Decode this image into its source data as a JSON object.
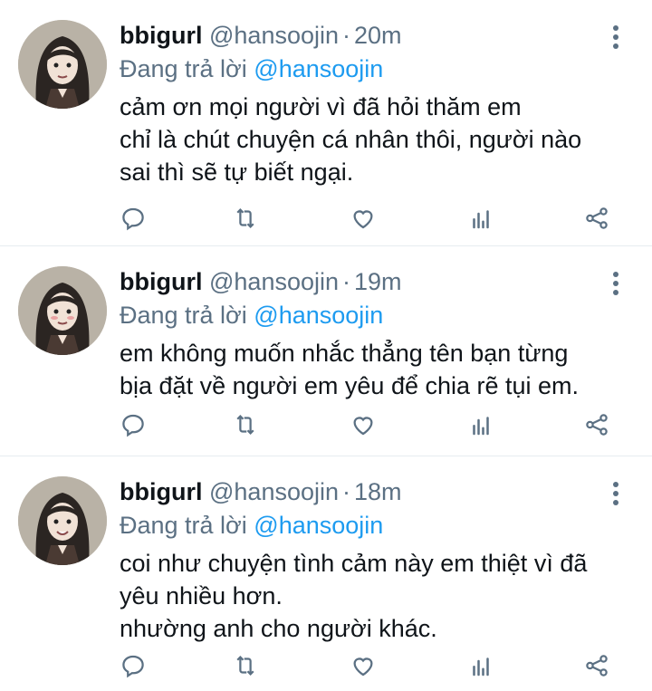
{
  "tweets": [
    {
      "name": "bbigurl",
      "handle": "@hansoojin",
      "separator": "·",
      "time": "20m",
      "reply_prefix": "Đang trả lời",
      "reply_to": "@hansoojin",
      "text": "cảm ơn mọi người vì đã hỏi thăm em\nchỉ là chút chuyện cá nhân thôi, người nào\nsai thì sẽ tự biết ngại."
    },
    {
      "name": "bbigurl",
      "handle": "@hansoojin",
      "separator": "·",
      "time": "19m",
      "reply_prefix": "Đang trả lời",
      "reply_to": "@hansoojin",
      "text": "em không muốn nhắc thẳng tên bạn từng\nbịa đặt về người em yêu để chia rẽ tụi em."
    },
    {
      "name": "bbigurl",
      "handle": "@hansoojin",
      "separator": "·",
      "time": "18m",
      "reply_prefix": "Đang trả lời",
      "reply_to": "@hansoojin",
      "text": "coi như chuyện tình cảm này em thiệt vì đã\nyêu nhiều hơn.\nnhường anh cho người khác."
    }
  ],
  "icons": {
    "reply": "reply-icon",
    "retweet": "retweet-icon",
    "like": "like-icon",
    "analytics": "analytics-icon",
    "share": "share-icon",
    "more": "more-vertical-icon"
  },
  "colors": {
    "text": "#0f1419",
    "secondary": "#5b7083",
    "mention": "#1d9bf0",
    "divider": "#e6ecf0"
  }
}
